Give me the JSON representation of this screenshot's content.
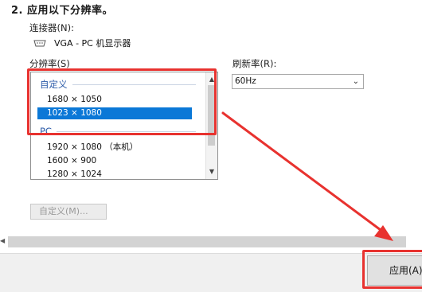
{
  "heading": "2. 应用以下分辨率。",
  "connector": {
    "label": "连接器(N):",
    "icon": "vga-connector-icon",
    "value": "VGA - PC 机显示器"
  },
  "resolution": {
    "label": "分辨率(S)",
    "groups": [
      {
        "name": "自定义",
        "items": [
          {
            "text": "1680 × 1050",
            "selected": false
          },
          {
            "text": "1023 × 1080",
            "selected": true
          }
        ]
      },
      {
        "name": "PC",
        "items": [
          {
            "text": "1920 × 1080 （本机）",
            "selected": false
          },
          {
            "text": "1600 × 900",
            "selected": false
          },
          {
            "text": "1280 × 1024",
            "selected": false
          }
        ]
      }
    ]
  },
  "refresh": {
    "label": "刷新率(R):",
    "value": "60Hz"
  },
  "custom_button": "自定义(M)...",
  "apply_button": "应用(A)",
  "colors": {
    "selection": "#0b78d7",
    "annotation": "#e8322f"
  }
}
